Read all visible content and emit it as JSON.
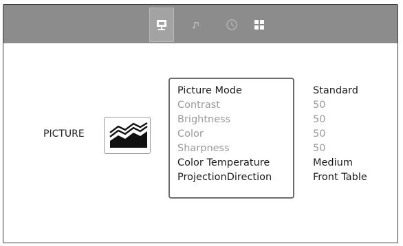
{
  "tabs": [
    {
      "icon": "display-icon",
      "active": true
    },
    {
      "icon": "music-note-icon",
      "active": false
    },
    {
      "icon": "clock-icon",
      "active": false
    },
    {
      "icon": "grid-apps-icon",
      "active": false
    }
  ],
  "section": {
    "label": "PICTURE",
    "icon": "picture-mode-icon"
  },
  "settings": [
    {
      "name": "Picture Mode",
      "value": "Standard",
      "enabled": true
    },
    {
      "name": "Contrast",
      "value": "50",
      "enabled": false
    },
    {
      "name": "Brightness",
      "value": "50",
      "enabled": false
    },
    {
      "name": "Color",
      "value": "50",
      "enabled": false
    },
    {
      "name": "Sharpness",
      "value": "50",
      "enabled": false
    },
    {
      "name": "Color Temperature",
      "value": "Medium",
      "enabled": true
    },
    {
      "name": "ProjectionDirection",
      "value": "Front Table",
      "enabled": true
    }
  ],
  "colors": {
    "topbar": "#8c8c8c",
    "active_tab": "#a3a3a3",
    "disabled_text": "#9a9a9a"
  }
}
